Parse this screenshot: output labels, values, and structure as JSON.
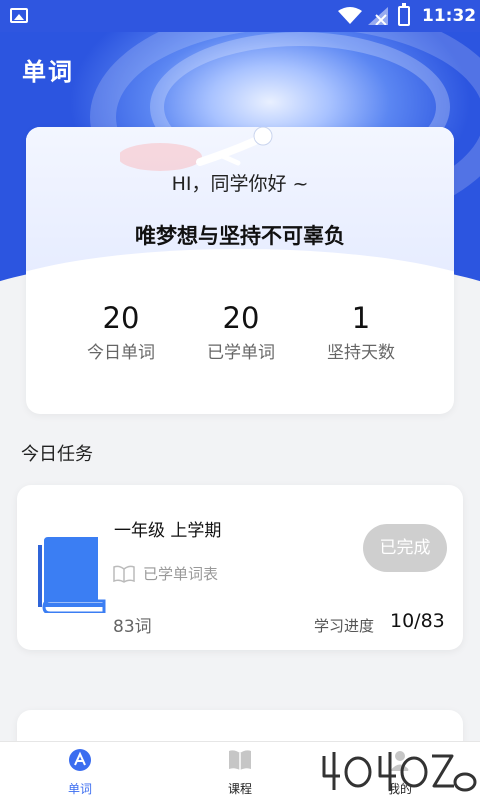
{
  "status_bar": {
    "time": "11:32",
    "icons": [
      "image-icon",
      "wifi-icon",
      "no-signal-icon",
      "battery-charging-icon"
    ]
  },
  "header": {
    "title": "单词"
  },
  "hero": {
    "greeting": "HI，同学你好 ~",
    "motto": "唯梦想与坚持不可辜负",
    "stats": [
      {
        "value": "20",
        "label": "今日单词"
      },
      {
        "value": "20",
        "label": "已学单词"
      },
      {
        "value": "1",
        "label": "坚持天数"
      }
    ]
  },
  "tasks": {
    "section_title": "今日任务",
    "items": [
      {
        "title": "一年级 上学期",
        "learned_label": "已学单词表",
        "status_button": "已完成",
        "word_count": "83词",
        "progress_label": "学习进度",
        "progress_value": "10/83"
      }
    ]
  },
  "bottom_nav": {
    "items": [
      {
        "label": "单词",
        "icon": "word-icon",
        "active": true
      },
      {
        "label": "课程",
        "icon": "book-open-icon",
        "active": false
      },
      {
        "label": "我的",
        "icon": "profile-icon",
        "active": false
      }
    ]
  },
  "colors": {
    "accent": "#3b6df0",
    "header_blue": "#2c55e0",
    "done_button": "#cfcfcf",
    "page_background": "#f2f3f5"
  }
}
